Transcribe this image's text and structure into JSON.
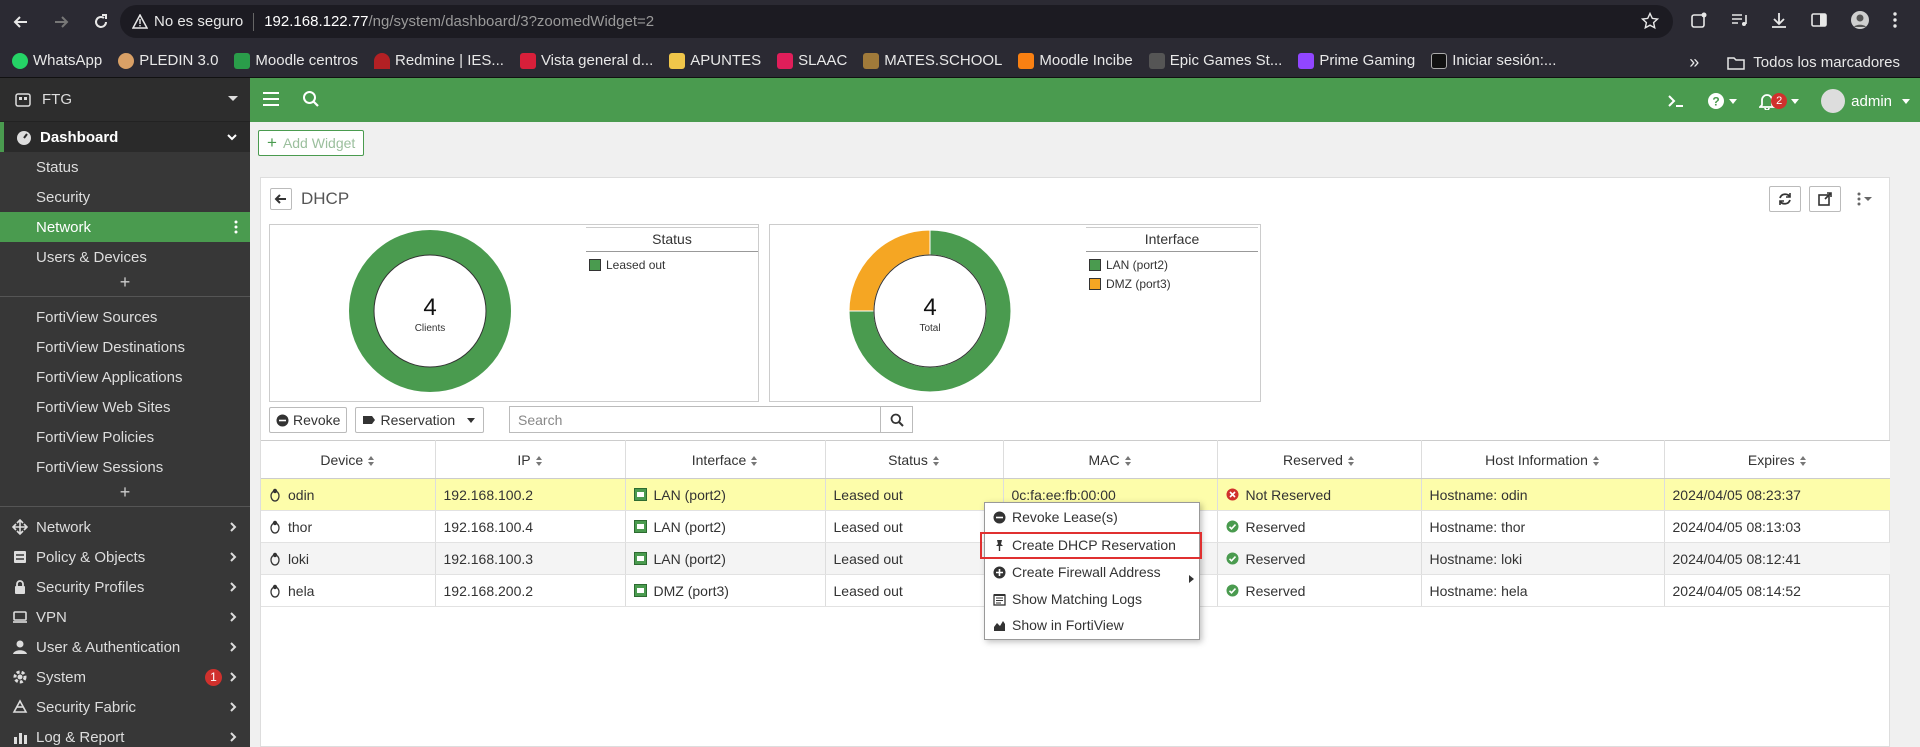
{
  "browser": {
    "security_warning": "No es seguro",
    "url_host": "192.168.122.77",
    "url_path": "/ng/system/dashboard/3?zoomedWidget=2",
    "bookmarks": [
      "WhatsApp",
      "PLEDIN 3.0",
      "Moodle centros",
      "Redmine | IES...",
      "Vista general d...",
      "APUNTES",
      "SLAAC",
      "MATES.SCHOOL",
      "Moodle Incibe",
      "Epic Games St...",
      "Prime Gaming",
      "Iniciar sesión:..."
    ],
    "more_bookmarks": "»",
    "all_bookmarks": "Todos los marcadores"
  },
  "sidebar": {
    "device_name": "FTG",
    "dashboard": "Dashboard",
    "dashboard_items": [
      "Status",
      "Security",
      "Network",
      "Users & Devices"
    ],
    "fortiview_items": [
      "FortiView Sources",
      "FortiView Destinations",
      "FortiView Applications",
      "FortiView Web Sites",
      "FortiView Policies",
      "FortiView Sessions"
    ],
    "menu": [
      "Network",
      "Policy & Objects",
      "Security Profiles",
      "VPN",
      "User & Authentication",
      "System",
      "Security Fabric",
      "Log & Report"
    ],
    "system_badge": "1",
    "plus": "+"
  },
  "topbar": {
    "notifications_count": "2",
    "user": "admin"
  },
  "content": {
    "add_widget": "Add Widget",
    "widget_title": "DHCP"
  },
  "charts": {
    "status": {
      "legend_title": "Status",
      "center_value": "4",
      "center_label": "Clients",
      "legend": [
        {
          "label": "Leased out",
          "color": "#4a9b4f"
        }
      ]
    },
    "interface": {
      "legend_title": "Interface",
      "center_value": "4",
      "center_label": "Total",
      "legend": [
        {
          "label": "LAN (port2)",
          "color": "#4a9b4f"
        },
        {
          "label": "DMZ (port3)",
          "color": "#f5a623"
        }
      ]
    }
  },
  "chart_data": [
    {
      "type": "pie",
      "categories": [
        "Leased out"
      ],
      "values": [
        4
      ],
      "colors": [
        "#4a9b4f"
      ],
      "title": "Status",
      "center_text": "4 Clients"
    },
    {
      "type": "pie",
      "categories": [
        "LAN (port2)",
        "DMZ (port3)"
      ],
      "values": [
        3,
        1
      ],
      "colors": [
        "#4a9b4f",
        "#f5a623"
      ],
      "title": "Interface",
      "center_text": "4 Total"
    }
  ],
  "toolbar": {
    "revoke": "Revoke",
    "reservation": "Reservation",
    "search_placeholder": "Search"
  },
  "table": {
    "headers": [
      "Device",
      "IP",
      "Interface",
      "Status",
      "MAC",
      "Reserved",
      "Host Information",
      "Expires"
    ],
    "rows": [
      {
        "device": "odin",
        "ip": "192.168.100.2",
        "interface": "LAN (port2)",
        "status": "Leased out",
        "mac": "0c:fa:ee:fb:00:00",
        "reserved": "Not Reserved",
        "host": "Hostname: odin",
        "expires": "2024/04/05 08:23:37"
      },
      {
        "device": "thor",
        "ip": "192.168.100.4",
        "interface": "LAN (port2)",
        "status": "Leased out",
        "mac": "",
        "reserved": "Reserved",
        "host": "Hostname: thor",
        "expires": "2024/04/05 08:13:03"
      },
      {
        "device": "loki",
        "ip": "192.168.100.3",
        "interface": "LAN (port2)",
        "status": "Leased out",
        "mac": "",
        "reserved": "Reserved",
        "host": "Hostname: loki",
        "expires": "2024/04/05 08:12:41"
      },
      {
        "device": "hela",
        "ip": "192.168.200.2",
        "interface": "DMZ (port3)",
        "status": "Leased out",
        "mac": "",
        "reserved": "Reserved",
        "host": "Hostname: hela",
        "expires": "2024/04/05 08:14:52"
      }
    ]
  },
  "context_menu": {
    "items": [
      "Revoke Lease(s)",
      "Create DHCP Reservation",
      "Create Firewall Address",
      "Show Matching Logs",
      "Show in FortiView"
    ]
  },
  "colors": {
    "accent_green": "#4a9b4f",
    "orange": "#f5a623",
    "highlight_row": "#fdfdaa",
    "alert_red": "#d0312d"
  }
}
